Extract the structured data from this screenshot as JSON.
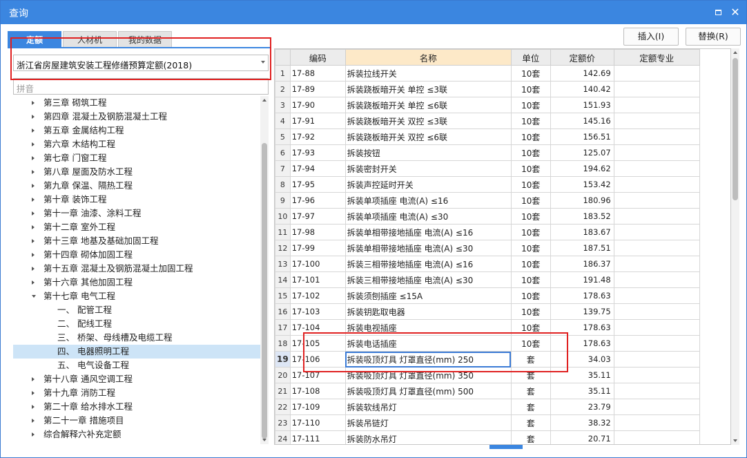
{
  "window": {
    "title": "查询"
  },
  "tabs": [
    {
      "label": "定额",
      "active": true
    },
    {
      "label": "人材机",
      "active": false
    },
    {
      "label": "我的数据",
      "active": false
    }
  ],
  "quota_select": {
    "value": "浙江省房屋建筑安装工程修缮预算定额(2018)"
  },
  "pinyin_input": {
    "placeholder": "拼音"
  },
  "buttons": {
    "insert": "插入(I)",
    "replace": "替换(R)"
  },
  "tree": [
    {
      "label": "第三章 砌筑工程",
      "level": 0,
      "expanded": false
    },
    {
      "label": "第四章 混凝土及钢筋混凝土工程",
      "level": 0,
      "expanded": false
    },
    {
      "label": "第五章 金属结构工程",
      "level": 0,
      "expanded": false
    },
    {
      "label": "第六章 木结构工程",
      "level": 0,
      "expanded": false
    },
    {
      "label": "第七章 门窗工程",
      "level": 0,
      "expanded": false
    },
    {
      "label": "第八章 屋面及防水工程",
      "level": 0,
      "expanded": false
    },
    {
      "label": "第九章 保温、隔热工程",
      "level": 0,
      "expanded": false
    },
    {
      "label": "第十章 装饰工程",
      "level": 0,
      "expanded": false
    },
    {
      "label": "第十一章 油漆、涂料工程",
      "level": 0,
      "expanded": false
    },
    {
      "label": "第十二章 室外工程",
      "level": 0,
      "expanded": false
    },
    {
      "label": "第十三章 地基及基础加固工程",
      "level": 0,
      "expanded": false
    },
    {
      "label": "第十四章 砌体加固工程",
      "level": 0,
      "expanded": false
    },
    {
      "label": "第十五章 混凝土及钢筋混凝土加固工程",
      "level": 0,
      "expanded": false
    },
    {
      "label": "第十六章 其他加固工程",
      "level": 0,
      "expanded": false
    },
    {
      "label": "第十七章 电气工程",
      "level": 0,
      "expanded": true
    },
    {
      "label": "一、 配管工程",
      "level": 1
    },
    {
      "label": "二、 配线工程",
      "level": 1
    },
    {
      "label": "三、 桥架、母线槽及电缆工程",
      "level": 1
    },
    {
      "label": "四、 电器照明工程",
      "level": 1,
      "selected": true
    },
    {
      "label": "五、 电气设备工程",
      "level": 1
    },
    {
      "label": "第十八章 通风空调工程",
      "level": 0,
      "expanded": false
    },
    {
      "label": "第十九章 消防工程",
      "level": 0,
      "expanded": false
    },
    {
      "label": "第二十章 给水排水工程",
      "level": 0,
      "expanded": false
    },
    {
      "label": "第二十一章 措施项目",
      "level": 0,
      "expanded": false
    },
    {
      "label": "综合解释六补充定额",
      "level": 0,
      "expanded": false
    }
  ],
  "grid": {
    "columns": [
      "",
      "编码",
      "名称",
      "单位",
      "定额价",
      "定额专业"
    ],
    "current_row": 19,
    "rows": [
      {
        "idx": "1",
        "code": "17-88",
        "name": "拆装拉线开关",
        "unit": "10套",
        "price": "142.69",
        "spec": ""
      },
      {
        "idx": "2",
        "code": "17-89",
        "name": "拆装跷板暗开关 单控 ≤3联",
        "unit": "10套",
        "price": "140.42",
        "spec": ""
      },
      {
        "idx": "3",
        "code": "17-90",
        "name": "拆装跷板暗开关 单控 ≤6联",
        "unit": "10套",
        "price": "151.93",
        "spec": ""
      },
      {
        "idx": "4",
        "code": "17-91",
        "name": "拆装跷板暗开关 双控 ≤3联",
        "unit": "10套",
        "price": "145.16",
        "spec": ""
      },
      {
        "idx": "5",
        "code": "17-92",
        "name": "拆装跷板暗开关 双控 ≤6联",
        "unit": "10套",
        "price": "156.51",
        "spec": ""
      },
      {
        "idx": "6",
        "code": "17-93",
        "name": "拆装按钮",
        "unit": "10套",
        "price": "125.07",
        "spec": ""
      },
      {
        "idx": "7",
        "code": "17-94",
        "name": "拆装密封开关",
        "unit": "10套",
        "price": "194.62",
        "spec": ""
      },
      {
        "idx": "8",
        "code": "17-95",
        "name": "拆装声控延时开关",
        "unit": "10套",
        "price": "153.42",
        "spec": ""
      },
      {
        "idx": "9",
        "code": "17-96",
        "name": "拆装单项插座 电流(A) ≤16",
        "unit": "10套",
        "price": "180.96",
        "spec": ""
      },
      {
        "idx": "10",
        "code": "17-97",
        "name": "拆装单项插座 电流(A) ≤30",
        "unit": "10套",
        "price": "183.52",
        "spec": ""
      },
      {
        "idx": "11",
        "code": "17-98",
        "name": "拆装单相带接地插座 电流(A) ≤16",
        "unit": "10套",
        "price": "183.67",
        "spec": ""
      },
      {
        "idx": "12",
        "code": "17-99",
        "name": "拆装单相带接地插座 电流(A) ≤30",
        "unit": "10套",
        "price": "187.51",
        "spec": ""
      },
      {
        "idx": "13",
        "code": "17-100",
        "name": "拆装三相带接地插座 电流(A) ≤16",
        "unit": "10套",
        "price": "186.37",
        "spec": ""
      },
      {
        "idx": "14",
        "code": "17-101",
        "name": "拆装三相带接地插座 电流(A) ≤30",
        "unit": "10套",
        "price": "191.48",
        "spec": ""
      },
      {
        "idx": "15",
        "code": "17-102",
        "name": "拆装须刨插座 ≤15A",
        "unit": "10套",
        "price": "178.63",
        "spec": ""
      },
      {
        "idx": "16",
        "code": "17-103",
        "name": "拆装钥匙取电器",
        "unit": "10套",
        "price": "139.75",
        "spec": ""
      },
      {
        "idx": "17",
        "code": "17-104",
        "name": "拆装电视插座",
        "unit": "10套",
        "price": "178.63",
        "spec": ""
      },
      {
        "idx": "18",
        "code": "17-105",
        "name": "拆装电话插座",
        "unit": "10套",
        "price": "178.63",
        "spec": ""
      },
      {
        "idx": "19",
        "code": "17-106",
        "name": "拆装吸顶灯具 灯罩直径(mm) 250",
        "unit": "套",
        "price": "34.03",
        "spec": ""
      },
      {
        "idx": "20",
        "code": "17-107",
        "name": "拆装吸顶灯具 灯罩直径(mm) 350",
        "unit": "套",
        "price": "35.11",
        "spec": ""
      },
      {
        "idx": "21",
        "code": "17-108",
        "name": "拆装吸顶灯具 灯罩直径(mm) 500",
        "unit": "套",
        "price": "35.11",
        "spec": ""
      },
      {
        "idx": "22",
        "code": "17-109",
        "name": "拆装软线吊灯",
        "unit": "套",
        "price": "23.79",
        "spec": ""
      },
      {
        "idx": "23",
        "code": "17-110",
        "name": "拆装吊链灯",
        "unit": "套",
        "price": "38.32",
        "spec": ""
      },
      {
        "idx": "24",
        "code": "17-111",
        "name": "拆装防水吊灯",
        "unit": "套",
        "price": "20.71",
        "spec": ""
      }
    ]
  },
  "colors": {
    "accent": "#3b86e0",
    "highlight_box": "#e02020",
    "selected_tree": "#cde4f7",
    "name_header": "#fde9c8"
  }
}
